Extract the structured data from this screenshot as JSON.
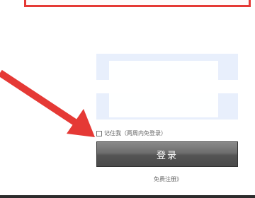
{
  "login": {
    "remember_label": "记住我（两周内免登录）",
    "login_button": "登录",
    "register_link": "免费注册》"
  },
  "annotation": {
    "arrow_icon": "red-arrow-icon",
    "highlight_color": "#e53935"
  },
  "colors": {
    "input_bg": "#e8effc",
    "button_dark": "#4a4a4a"
  }
}
